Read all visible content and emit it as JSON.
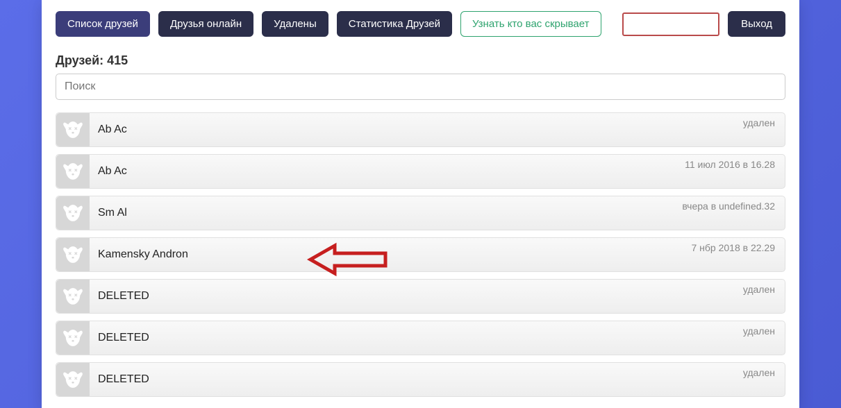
{
  "nav": {
    "friends_list": "Список друзей",
    "friends_online": "Друзья онлайн",
    "deleted": "Удалены",
    "friends_stats": "Статистика Друзей",
    "who_hides": "Узнать кто вас скрывает"
  },
  "token_input": "",
  "exit_label": "Выход",
  "friends_count_label": "Друзей: 415",
  "search_placeholder": "Поиск",
  "friends": [
    {
      "name": "Ab Ac",
      "status": "удален"
    },
    {
      "name": "Ab Ac",
      "status": "11 июл 2016 в 16.28"
    },
    {
      "name": "Sm Al",
      "status": "вчера в undefined.32"
    },
    {
      "name": "Kamensky Andron",
      "status": "7 нбр 2018 в 22.29"
    },
    {
      "name": "DELETED",
      "status": "удален"
    },
    {
      "name": "DELETED",
      "status": "удален"
    },
    {
      "name": "DELETED",
      "status": "удален"
    }
  ],
  "colors": {
    "primary_dark": "#2b2e4a",
    "active": "#3b3d7a",
    "accent_green": "#2ea36e",
    "token_border": "#b94a4a",
    "arrow_red": "#c61f1f",
    "bg_gradient_start": "#5b6de8",
    "bg_gradient_end": "#4a5bd4"
  }
}
